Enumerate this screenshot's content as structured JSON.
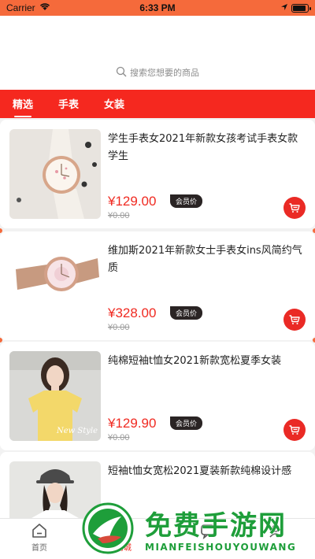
{
  "status_bar": {
    "carrier": "Carrier",
    "time": "6:33 PM"
  },
  "search": {
    "placeholder": "搜索您想要的商品",
    "icon": "search-icon"
  },
  "tabs": [
    {
      "label": "精选",
      "active": true
    },
    {
      "label": "手表",
      "active": false
    },
    {
      "label": "女装",
      "active": false
    }
  ],
  "products": [
    {
      "title": "学生手表女2021年新款女孩考试手表女款学生",
      "price": "¥129.00",
      "member_tag": "会员价",
      "original_price": "¥0.00"
    },
    {
      "title": "维加斯2021年新款女士手表女ins风简约气质",
      "price": "¥328.00",
      "member_tag": "会员价",
      "original_price": "¥0.00"
    },
    {
      "title": "纯棉短袖t恤女2021新款宽松夏季女装",
      "price": "¥129.90",
      "member_tag": "会员价",
      "original_price": "¥0.00"
    },
    {
      "title": "短袖t恤女宽松2021夏装新款纯棉设计感",
      "price": "",
      "member_tag": "",
      "original_price": ""
    }
  ],
  "bottom_nav": [
    {
      "label": "首页",
      "icon": "home-icon",
      "active": false
    },
    {
      "label": "商城",
      "icon": "store-icon",
      "active": true
    },
    {
      "label": "",
      "icon": "chat-icon",
      "active": false
    },
    {
      "label": "",
      "icon": "user-icon",
      "active": false
    }
  ],
  "watermark": {
    "title": "免费手游网",
    "subtitle": "MIANFEISHOUYOUWANG"
  },
  "colors": {
    "accent": "#f5281f",
    "status_bar": "#f56a3b",
    "price": "#f02a21",
    "member_tag_bg": "#2a2424",
    "watermark": "#1e9e3a"
  }
}
